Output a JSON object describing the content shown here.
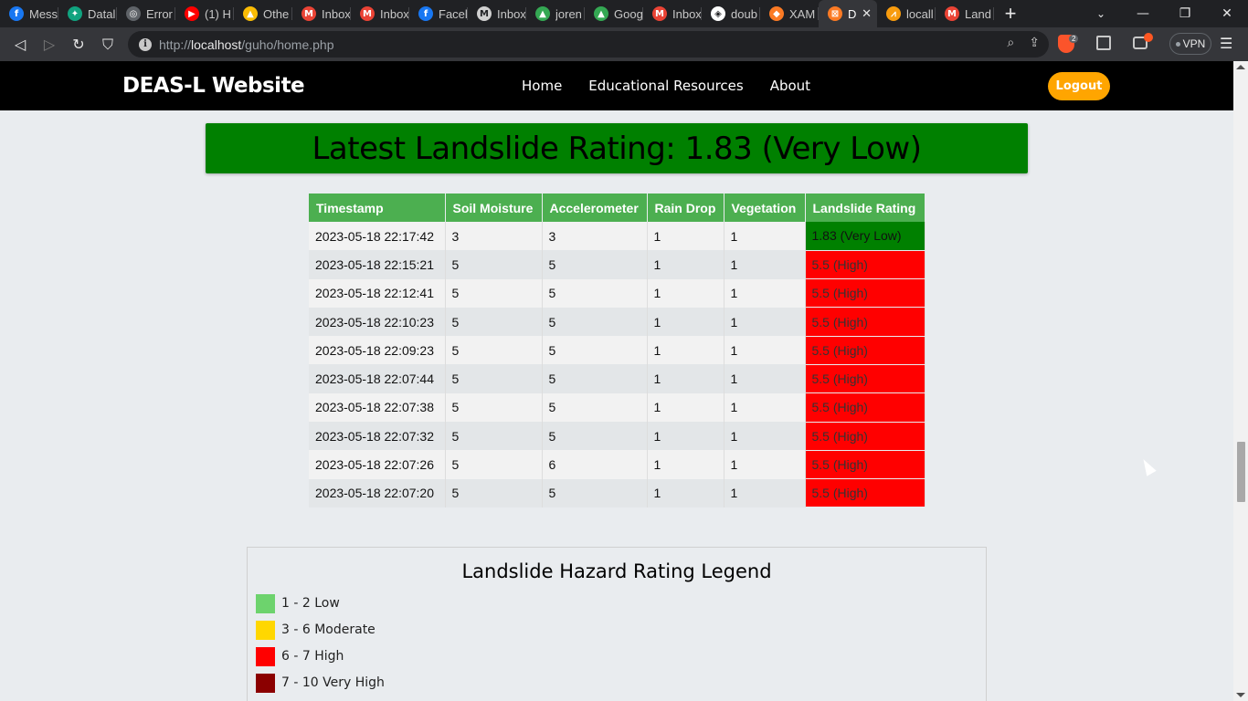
{
  "browser": {
    "tabs": [
      {
        "title": "Mess",
        "icon": "facebook-icon",
        "color": "#1877f2",
        "glyph": "f"
      },
      {
        "title": "Datal",
        "icon": "chatgpt-icon",
        "color": "#10a37f",
        "glyph": "✦"
      },
      {
        "title": "Error",
        "icon": "globe-icon",
        "color": "#5f6368",
        "glyph": "◎"
      },
      {
        "title": "(1) H",
        "icon": "youtube-icon",
        "color": "#ff0000",
        "glyph": "▶"
      },
      {
        "title": "Othe",
        "icon": "google-drive-icon",
        "color": "#fbbc04",
        "glyph": "▲"
      },
      {
        "title": "Inbox",
        "icon": "gmail-icon",
        "color": "#ea4335",
        "glyph": "M"
      },
      {
        "title": "Inbox",
        "icon": "gmail-icon",
        "color": "#ea4335",
        "glyph": "M"
      },
      {
        "title": "Facel",
        "icon": "facebook-icon",
        "color": "#1877f2",
        "glyph": "f"
      },
      {
        "title": "Inbox",
        "icon": "mail-icon",
        "color": "#d0d0d0",
        "glyph": "M"
      },
      {
        "title": "joren",
        "icon": "google-drive-icon",
        "color": "#34a853",
        "glyph": "▲"
      },
      {
        "title": "Goog",
        "icon": "google-drive-icon",
        "color": "#34a853",
        "glyph": "▲"
      },
      {
        "title": "Inbox",
        "icon": "gmail-icon",
        "color": "#ea4335",
        "glyph": "M"
      },
      {
        "title": "doub",
        "icon": "codepen-icon",
        "color": "#ffffff",
        "glyph": "◈"
      },
      {
        "title": "XAM",
        "icon": "xampp-icon",
        "color": "#fb7a24",
        "glyph": "◆"
      },
      {
        "title": "D",
        "icon": "xampp-icon",
        "color": "#fb7a24",
        "glyph": "⊠",
        "active": true
      },
      {
        "title": "locall",
        "icon": "phpmyadmin-icon",
        "color": "#f89c0e",
        "glyph": "⩘"
      },
      {
        "title": "Land",
        "icon": "gmail-icon",
        "color": "#ea4335",
        "glyph": "M"
      }
    ],
    "url_prefix": "http://",
    "url_host": "localhost",
    "url_path": "/guho/home.php",
    "brave_count": "2",
    "vpn_label": "VPN"
  },
  "site": {
    "brand": "DEAS-L Website",
    "nav": [
      "Home",
      "Educational Resources",
      "About"
    ],
    "logout_label": "Logout"
  },
  "banner": {
    "text": "Latest Landslide Rating: 1.83 (Very Low)",
    "color": "#008000"
  },
  "table": {
    "headers": [
      "Timestamp",
      "Soil Moisture",
      "Accelerometer",
      "Rain Drop",
      "Vegetation",
      "Landslide Rating"
    ],
    "rows": [
      [
        "2023-05-18 22:17:42",
        "3",
        "3",
        "1",
        "1",
        "1.83 (Very Low)",
        "low"
      ],
      [
        "2023-05-18 22:15:21",
        "5",
        "5",
        "1",
        "1",
        "5.5 (High)",
        "high"
      ],
      [
        "2023-05-18 22:12:41",
        "5",
        "5",
        "1",
        "1",
        "5.5 (High)",
        "high"
      ],
      [
        "2023-05-18 22:10:23",
        "5",
        "5",
        "1",
        "1",
        "5.5 (High)",
        "high"
      ],
      [
        "2023-05-18 22:09:23",
        "5",
        "5",
        "1",
        "1",
        "5.5 (High)",
        "high"
      ],
      [
        "2023-05-18 22:07:44",
        "5",
        "5",
        "1",
        "1",
        "5.5 (High)",
        "high"
      ],
      [
        "2023-05-18 22:07:38",
        "5",
        "5",
        "1",
        "1",
        "5.5 (High)",
        "high"
      ],
      [
        "2023-05-18 22:07:32",
        "5",
        "5",
        "1",
        "1",
        "5.5 (High)",
        "high"
      ],
      [
        "2023-05-18 22:07:26",
        "5",
        "6",
        "1",
        "1",
        "5.5 (High)",
        "high"
      ],
      [
        "2023-05-18 22:07:20",
        "5",
        "5",
        "1",
        "1",
        "5.5 (High)",
        "high"
      ]
    ]
  },
  "legend": {
    "title": "Landslide Hazard Rating Legend",
    "items": [
      {
        "label": "1 - 2 Low",
        "color": "#6dd36d"
      },
      {
        "label": "3 - 6 Moderate",
        "color": "#ffd700"
      },
      {
        "label": "6 - 7 High",
        "color": "#ff0000"
      },
      {
        "label": "7 - 10 Very High",
        "color": "#8b0000"
      }
    ]
  }
}
